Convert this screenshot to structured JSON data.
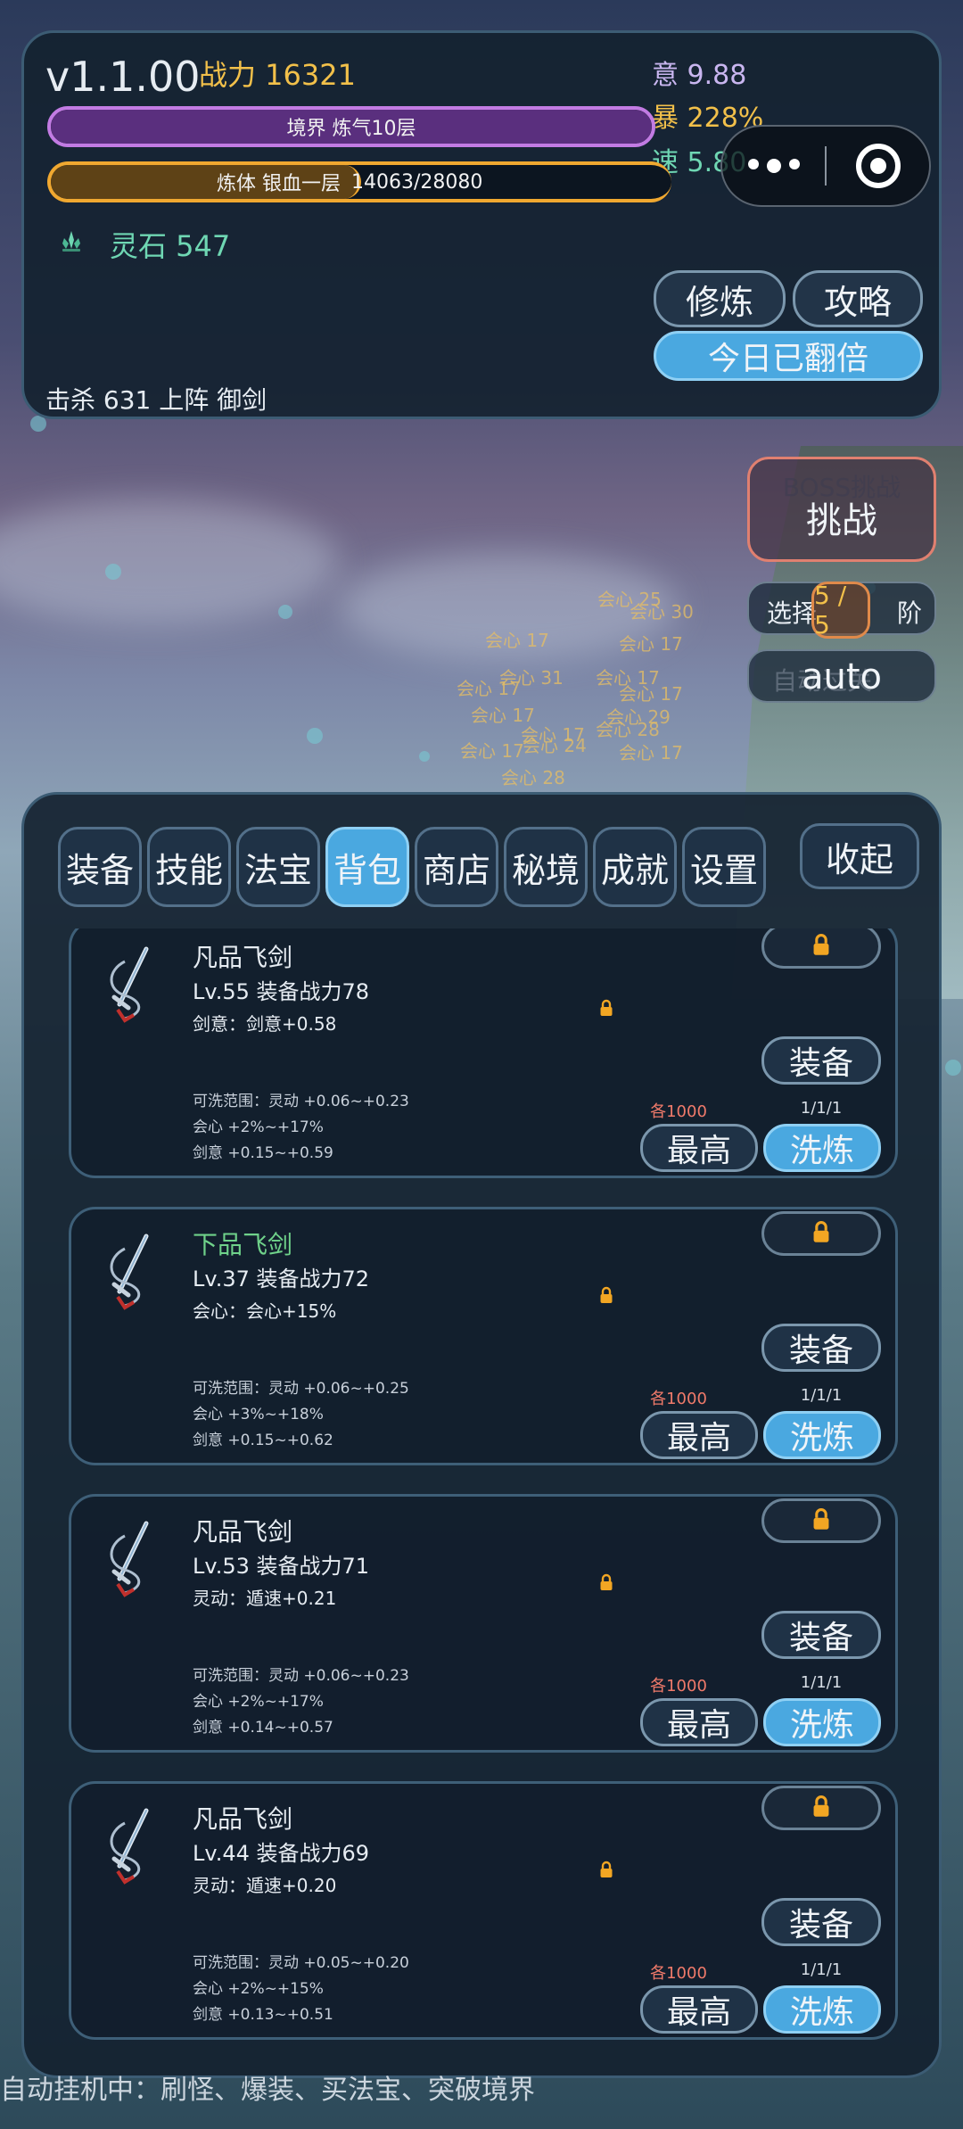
{
  "header": {
    "version": "v1.1.00",
    "power": "战力 16321",
    "stats": {
      "yi": "意 9.88",
      "bao": "暴 228%",
      "su": "速 5.80"
    },
    "realm": {
      "label": "境界 炼气10层",
      "progress": 1.0
    },
    "body": {
      "label": "炼体 银血一层",
      "value": "14063/28080",
      "progress": 0.5
    },
    "stone": "灵石 547",
    "buttons": {
      "cultivate": "修炼",
      "guide": "攻略",
      "double": "今日已翻倍"
    },
    "kill": "击杀 631  上阵 御剑"
  },
  "capsule": {
    "more_icon": "more-dots-icon",
    "close_icon": "target-icon"
  },
  "controls": {
    "boss_ghost": "BOSS挑战",
    "boss": "挑战",
    "select_label": "选择",
    "select_value": "5 / 5",
    "select_unit": "阶",
    "auto_ghost": "自动过关",
    "auto": "auto"
  },
  "floats": [
    "会心 25",
    "会心 30",
    "会心 17",
    "会心 17",
    "会心 31",
    "会心 17",
    "会心 17",
    "会心 17",
    "会心 17",
    "会心 29",
    "会心 17",
    "会心 28",
    "会心 17",
    "会心 24",
    "会心 17",
    "会心 28"
  ],
  "tabs": [
    {
      "label": "装备",
      "active": false
    },
    {
      "label": "技能",
      "active": false
    },
    {
      "label": "法宝",
      "active": false
    },
    {
      "label": "背包",
      "active": true
    },
    {
      "label": "商店",
      "active": false
    },
    {
      "label": "秘境",
      "active": false
    },
    {
      "label": "成就",
      "active": false
    },
    {
      "label": "设置",
      "active": false
    }
  ],
  "collapse": "收起",
  "items": [
    {
      "name": "凡品飞剑",
      "quality": "normal",
      "lv": "Lv.55  装备战力78",
      "affix": "剑意：剑意+0.58",
      "ranges": [
        "可洗范围：灵动 +0.06~+0.23",
        "会心 +2%~+17%",
        "剑意 +0.15~+0.59"
      ],
      "equip": "装备",
      "cost": "各1000",
      "count": "1/1/1",
      "max": "最高",
      "wash": "洗炼"
    },
    {
      "name": "下品飞剑",
      "quality": "green",
      "lv": "Lv.37  装备战力72",
      "affix": "会心：会心+15%",
      "ranges": [
        "可洗范围：灵动 +0.06~+0.25",
        "会心 +3%~+18%",
        "剑意 +0.15~+0.62"
      ],
      "equip": "装备",
      "cost": "各1000",
      "count": "1/1/1",
      "max": "最高",
      "wash": "洗炼"
    },
    {
      "name": "凡品飞剑",
      "quality": "normal",
      "lv": "Lv.53  装备战力71",
      "affix": "灵动：遁速+0.21",
      "ranges": [
        "可洗范围：灵动 +0.06~+0.23",
        "会心 +2%~+17%",
        "剑意 +0.14~+0.57"
      ],
      "equip": "装备",
      "cost": "各1000",
      "count": "1/1/1",
      "max": "最高",
      "wash": "洗炼"
    },
    {
      "name": "凡品飞剑",
      "quality": "normal",
      "lv": "Lv.44  装备战力69",
      "affix": "灵动：遁速+0.20",
      "ranges": [
        "可洗范围：灵动 +0.05~+0.20",
        "会心 +2%~+15%",
        "剑意 +0.13~+0.51"
      ],
      "equip": "装备",
      "cost": "各1000",
      "count": "1/1/1",
      "max": "最高",
      "wash": "洗炼"
    }
  ],
  "status": "自动挂机中：刷怪、爆装、买法宝、突破境界",
  "colors": {
    "accent": "#4aa8e0",
    "gold": "#f2c04a",
    "jade": "#6fd7b3",
    "purple": "#c27be3",
    "red": "#f07a6a",
    "green": "#6fd28a"
  }
}
